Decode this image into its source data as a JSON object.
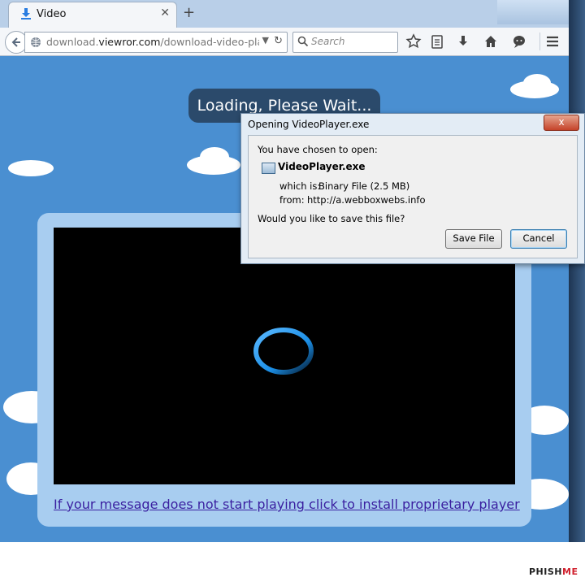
{
  "browser": {
    "tab_title": "Video",
    "new_tab": "+",
    "url_domain_prefix": "download.",
    "url_domain": "viewror.com",
    "url_path": "/download-video-player.php",
    "search_placeholder": "Search"
  },
  "page": {
    "loading_text": "Loading, Please Wait...",
    "install_link": "If your message does not start playing click to install proprietary player"
  },
  "dialog": {
    "title": "Opening VideoPlayer.exe",
    "close": "x",
    "intro": "You have chosen to open:",
    "file_name": "VideoPlayer.exe",
    "which_is_label": "which is:",
    "which_is_value": "Binary File (2.5 MB)",
    "from_label": "from:",
    "from_value": "http://a.webboxwebs.info",
    "question": "Would you like to save this file?",
    "save_button": "Save File",
    "cancel_button": "Cancel"
  },
  "logo": {
    "text_a": "PHISH",
    "text_b": "ME"
  },
  "colors": {
    "page_bg": "#4a8fd1",
    "dialog_bg": "#e3ecf5",
    "link": "#3a1fa0",
    "spinner": "#1c8fe6"
  }
}
